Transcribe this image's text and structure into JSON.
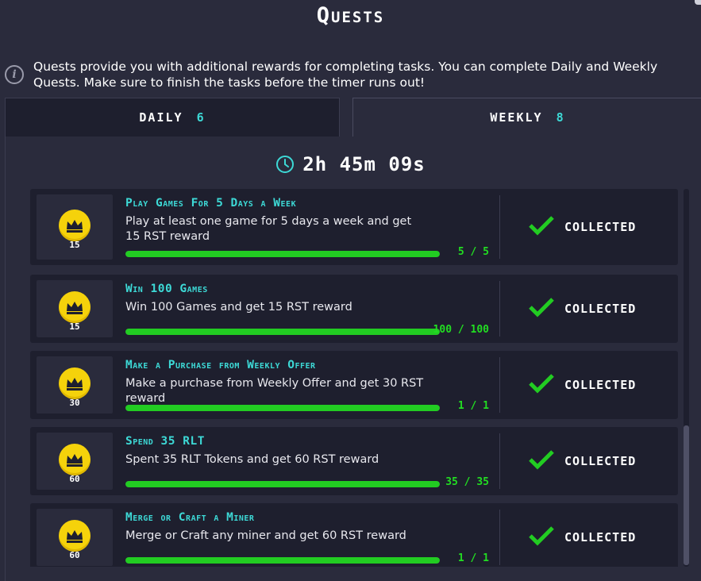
{
  "header": {
    "title": "Quests"
  },
  "info": {
    "text": "Quests provide you with additional rewards for completing tasks. You can complete Daily and Weekly Quests. Make sure to finish the tasks before the timer runs out!"
  },
  "tabs": [
    {
      "label": "DAILY",
      "count": "6",
      "active": false
    },
    {
      "label": "WEEKLY",
      "count": "8",
      "active": true
    }
  ],
  "timer": {
    "text": "2h 45m 09s"
  },
  "quests": [
    {
      "title": "Play Games For 5 Days a Week",
      "description": "Play at least one game for 5 days a week and get 15 RST reward",
      "reward": "15",
      "progress_text": "5 / 5",
      "progress": 1.0,
      "status": "COLLECTED"
    },
    {
      "title": "Win 100 Games",
      "description": "Win 100 Games and get 15 RST reward",
      "reward": "15",
      "progress_text": "100 / 100",
      "progress": 1.0,
      "status": "COLLECTED"
    },
    {
      "title": "Make a Purchase from Weekly Offer",
      "description": "Make a purchase from Weekly Offer and get 30 RST reward",
      "reward": "30",
      "progress_text": "1 / 1",
      "progress": 1.0,
      "status": "COLLECTED"
    },
    {
      "title": "Spend 35 RLT",
      "description": "Spent 35 RLT Tokens and get 60 RST reward",
      "reward": "60",
      "progress_text": "35 / 35",
      "progress": 1.0,
      "status": "COLLECTED"
    },
    {
      "title": "Merge or Craft a Miner",
      "description": "Merge or Craft any miner and get 60 RST reward",
      "reward": "60",
      "progress_text": "1 / 1",
      "progress": 1.0,
      "status": "COLLECTED"
    }
  ],
  "colors": {
    "accent": "#3dd9d6",
    "progress": "#22cc22",
    "coin": "#f5d20b",
    "background": "#2a2b3c",
    "card": "#1e1f2e"
  },
  "icons": {
    "info": "info-icon",
    "timer": "clock-icon",
    "reward": "crown-coin-icon",
    "status": "checkmark-icon"
  }
}
